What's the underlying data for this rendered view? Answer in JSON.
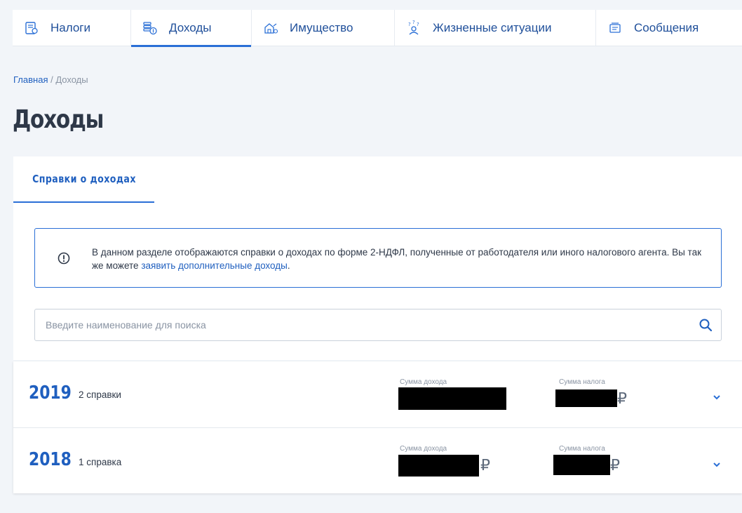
{
  "nav": {
    "items": [
      {
        "label": "Налоги",
        "icon": "document-icon",
        "active": false
      },
      {
        "label": "Доходы",
        "icon": "coins-icon",
        "active": true
      },
      {
        "label": "Имущество",
        "icon": "house-icon",
        "active": false
      },
      {
        "label": "Жизненные ситуации",
        "icon": "question-person-icon",
        "active": false
      },
      {
        "label": "Сообщения",
        "icon": "message-icon",
        "active": false
      }
    ]
  },
  "breadcrumb": {
    "home": "Главная",
    "separator": " / ",
    "current": "Доходы"
  },
  "page_title": "Доходы",
  "tab": {
    "label": "Справки о доходах"
  },
  "info": {
    "text": "В данном разделе отображаются справки о доходах по форме 2-НДФЛ, полученные от работодателя или иного налогового агента. Вы так же можете ",
    "link": "заявить дополнительные доходы",
    "suffix": "."
  },
  "search": {
    "placeholder": "Введите наименование для поиска"
  },
  "years": [
    {
      "year": "2019",
      "count": "2 справки",
      "income_caption": "Сумма дохода",
      "tax_caption": "Сумма налога",
      "currency": "₽"
    },
    {
      "year": "2018",
      "count": "1 справка",
      "income_caption": "Сумма дохода",
      "tax_caption": "Сумма налога",
      "currency": "₽"
    }
  ],
  "colors": {
    "accent": "#2a6fd6",
    "link": "#1f5fbf",
    "background": "#f2f5f9"
  }
}
